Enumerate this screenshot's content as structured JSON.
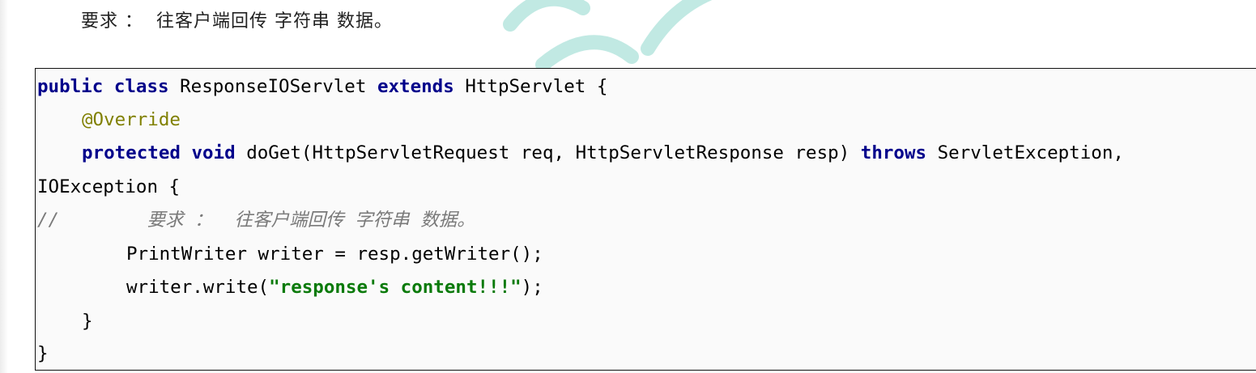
{
  "heading": "要求 ：  往客户端回传 字符串 数据。",
  "code": {
    "line1": {
      "kw1": "public",
      "kw2": "class",
      "name": "ResponseIOServlet",
      "kw3": "extends",
      "rest": "HttpServlet {"
    },
    "line2": {
      "annotation": "@Override"
    },
    "line3": {
      "kw1": "protected",
      "kw2": "void",
      "mid": "doGet(HttpServletRequest req, HttpServletResponse resp)",
      "kw3": "throws",
      "rest": "ServletException,"
    },
    "line4": {
      "text": "IOException {"
    },
    "line5": {
      "comment": "//        要求 ：  往客户端回传 字符串 数据。"
    },
    "line6": {
      "text": "PrintWriter writer = resp.getWriter();"
    },
    "line7": {
      "pre": "writer.write(",
      "string": "\"response's content!!!\"",
      "post": ");"
    },
    "line8": {
      "text": "}"
    },
    "line9": {
      "text": "}"
    }
  },
  "colors": {
    "keyword": "#00008b",
    "annotation": "#808000",
    "string": "#0a7a0a",
    "comment": "#7a7a7a",
    "watermark": "#4fc3b0"
  }
}
